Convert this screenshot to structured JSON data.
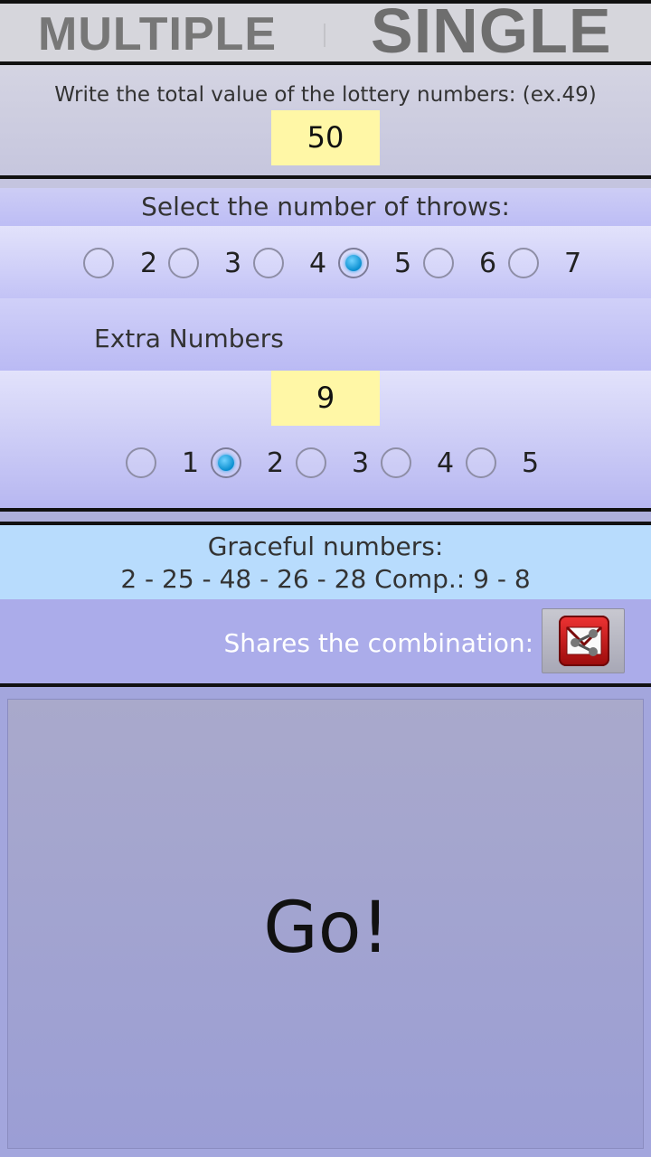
{
  "tabs": {
    "multiple": "MULTIPLE",
    "single": "SINGLE"
  },
  "total": {
    "label": "Write the total value of the lottery numbers: (ex.49)",
    "value": "50"
  },
  "throws": {
    "label": "Select the number of throws:",
    "options": [
      "2",
      "3",
      "4",
      "5",
      "6",
      "7"
    ],
    "selected": "5"
  },
  "extra": {
    "label": "Extra Numbers",
    "value": "9",
    "options": [
      "1",
      "2",
      "3",
      "4",
      "5"
    ],
    "selected": "2"
  },
  "result": {
    "title": "Graceful numbers:",
    "numbers": "2 - 25 - 48 - 26 - 28 Comp.: 9 - 8"
  },
  "share": {
    "label": "Shares the combination:",
    "icon": "share-mail-icon",
    "icon_color": "#cc1a1a"
  },
  "go": {
    "label": "Go!"
  },
  "colors": {
    "field_bg": "#fff7a6",
    "accent_radio": "#0a8fd0",
    "graceful_bg": "#b8dcfd"
  }
}
